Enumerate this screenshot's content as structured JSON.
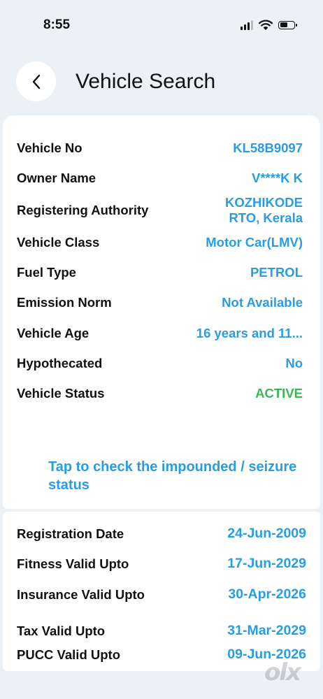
{
  "status_bar": {
    "time": "8:55"
  },
  "header": {
    "title": "Vehicle Search",
    "back_icon": "chevron-left-icon"
  },
  "vehicle_details": [
    {
      "label": "Vehicle No",
      "value": "KL58B9097"
    },
    {
      "label": "Owner Name",
      "value": "V****K K"
    },
    {
      "label": "Registering Authority",
      "value_line1": "KOZHIKODE",
      "value_line2": "RTO, Kerala"
    },
    {
      "label": "Vehicle Class",
      "value": "Motor Car(LMV)"
    },
    {
      "label": "Fuel Type",
      "value": "PETROL"
    },
    {
      "label": "Emission Norm",
      "value": "Not Available"
    },
    {
      "label": "Vehicle Age",
      "value": "16 years and 11..."
    },
    {
      "label": "Hypothecated",
      "value": "No"
    },
    {
      "label": "Vehicle Status",
      "value": "ACTIVE"
    }
  ],
  "impound_link": "Tap to check the impounded / seizure status",
  "validity": [
    {
      "label": "Registration Date",
      "value": "24-Jun-2009"
    },
    {
      "label": "Fitness Valid Upto",
      "value": "17-Jun-2029"
    },
    {
      "label": "Insurance Valid Upto",
      "value": "30-Apr-2026"
    },
    {
      "label": "Tax Valid Upto",
      "value": "31-Mar-2029"
    },
    {
      "label": "PUCC Valid Upto",
      "value": "09-Jun-2026"
    }
  ],
  "watermark": "olx",
  "colors": {
    "accent": "#2a9de0",
    "active": "#3db655",
    "background": "#ecf1f6"
  }
}
